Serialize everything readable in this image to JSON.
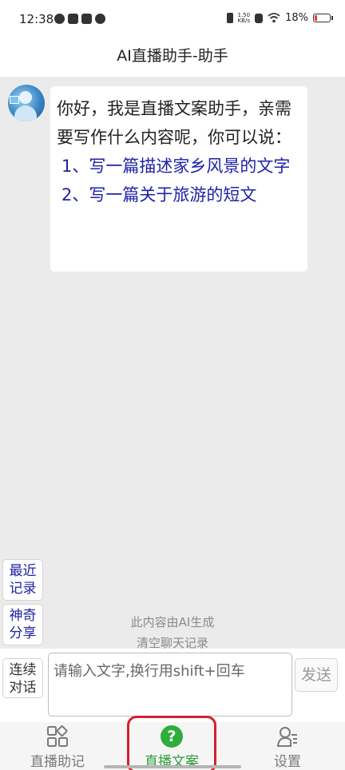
{
  "status_bar": {
    "time": "12:38",
    "speed_value": "1.50",
    "speed_unit": "KB/s",
    "battery_text": "18%",
    "battery_level": 0.18,
    "battery_color": "#e53935"
  },
  "header": {
    "title": "AI直播助手-助手"
  },
  "chat": {
    "greeting": "你好，我是直播文案助手，亲需要写作什么内容呢，你可以说：",
    "suggestions": [
      {
        "label": "1、写一篇描述家乡风景的文字"
      },
      {
        "label": "2、写一篇关于旅游的短文"
      }
    ],
    "ai_note": "此内容由AI生成",
    "clear_label": "清空聊天记录"
  },
  "side_buttons": {
    "recent": "最近记录",
    "magic_share": "神奇分享",
    "continuous": "连续对话"
  },
  "input": {
    "placeholder": "请输入文字,换行用shift+回车",
    "value": "",
    "send_label": "发送"
  },
  "bottom_nav": {
    "items": [
      {
        "label": "直播助记",
        "icon": "grid-apps-icon",
        "active": false
      },
      {
        "label": "直播文案",
        "icon": "help-circle-icon",
        "active": true
      },
      {
        "label": "设置",
        "icon": "user-settings-icon",
        "active": false
      }
    ],
    "active_color": "#2e9e3e",
    "highlight_color": "#d5202b"
  }
}
